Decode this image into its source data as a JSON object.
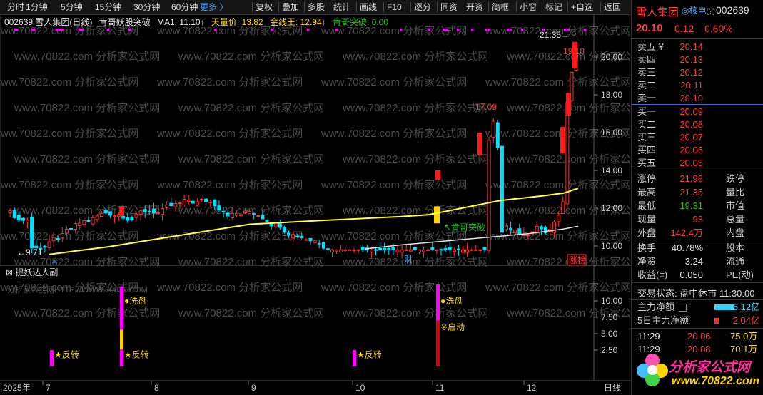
{
  "toolbar": {
    "left": [
      "分时",
      "1分钟",
      "5分钟",
      "15分钟",
      "30分钟",
      "60分钟"
    ],
    "more": "更多 〉",
    "right": [
      "复权",
      "叠加",
      "多股",
      "统计",
      "画线",
      "F10",
      "逐分",
      "同资",
      "开资",
      "简框",
      "小窗",
      "标记",
      "+自选",
      "返回"
    ]
  },
  "info": {
    "code_name": "002639 雪人集团(日线)",
    "indicator": "肯哥妖股突破",
    "ma1": "MA1: 11.10↑",
    "tianliang": "天量价: 13.82",
    "jinxian": "金线王: 12.94↑",
    "kenge": "肯哥突破: 0.00"
  },
  "price_axis": [
    "20.00",
    "18.00",
    "16.00",
    "14.00",
    "12.00",
    "10.00"
  ],
  "sub_axis": [
    "10.00",
    "7.50",
    "5.00",
    "2.50"
  ],
  "sub_title": "捉妖达人副",
  "date_axis": {
    "year": "2025年",
    "months": [
      "7",
      "8",
      "9",
      "10",
      "11",
      "12"
    ],
    "corner": "日线"
  },
  "annotations": {
    "high_recent": "21.35",
    "last_price_label": "19.18",
    "peak": "17.09",
    "low": "9.71",
    "break_label": "肯哥突破",
    "cai": "财",
    "zhangbang": "涨榜"
  },
  "sub_annotations": {
    "xipan1": "●洗盘",
    "xipan2": "●洗盘",
    "qidong": "※启动",
    "fanzhuan": [
      "★反转",
      "★反转",
      "★反转"
    ]
  },
  "watermarks": {
    "site_row": "www.70822.com 分析家公式网",
    "site_url": "分析家公式网HTTP://WWW.70822.COM"
  },
  "panel": {
    "name": "雪人集团",
    "tag": "核电",
    "help": "(?)",
    "code": "002639",
    "price": "20.10",
    "change": "0.12",
    "pct": "0.60%",
    "sells": [
      {
        "label": "卖五",
        "flag": "¥",
        "price": "20.14"
      },
      {
        "label": "卖四",
        "flag": "",
        "price": "20.13"
      },
      {
        "label": "卖三",
        "flag": "",
        "price": "20.12"
      },
      {
        "label": "卖二",
        "flag": "",
        "price": "20.11"
      },
      {
        "label": "卖一",
        "flag": "",
        "price": "20.10"
      }
    ],
    "buys": [
      {
        "label": "买一",
        "price": "20.09"
      },
      {
        "label": "买二",
        "price": "20.08"
      },
      {
        "label": "买三",
        "price": "20.07"
      },
      {
        "label": "买四",
        "price": "20.06"
      },
      {
        "label": "买五",
        "price": "20.05"
      }
    ],
    "stats1": [
      {
        "l": "涨停",
        "v": "21.98",
        "l2": "跌停"
      },
      {
        "l": "最高",
        "v": "21.35",
        "l2": "量比"
      },
      {
        "l": "最低",
        "v": "19.31",
        "l2": "市值"
      },
      {
        "l": "现量",
        "v": "93",
        "l2": "总量"
      },
      {
        "l": "外盘",
        "v": "142.4万",
        "l2": "内盘"
      }
    ],
    "stats2": [
      {
        "l": "换手",
        "v": "40.78%",
        "l2": "股本"
      },
      {
        "l": "净资",
        "v": "3.24",
        "l2": "流通"
      },
      {
        "l": "收益(≡)",
        "v": "0.050",
        "l2": "PE(动)"
      }
    ],
    "trade_state": "交易状态: 盘中休市 11:30:00",
    "main_net": {
      "label": "主力净额",
      "value": "-6.12亿"
    },
    "five_day": {
      "label": "5日主力净额",
      "value": "2.04亿"
    },
    "ticks": [
      {
        "t": "11:29",
        "p": "20.06",
        "v": "75.0万"
      },
      {
        "t": "11:29",
        "p": "20.08",
        "v": "70.1万"
      }
    ],
    "logo_text": "分析家公式网",
    "logo_url": "www.70822.com"
  },
  "colors": {
    "up": "#ff3030",
    "down": "#00e0ff",
    "ma": "#ffff40",
    "magenta": "#ff00ff"
  }
}
